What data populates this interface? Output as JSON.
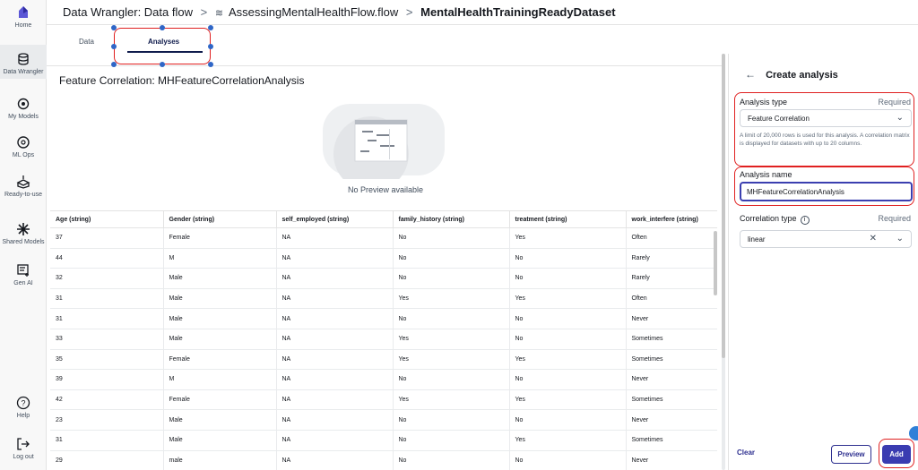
{
  "nav": {
    "items": [
      {
        "label": "Home",
        "icon": "home-icon"
      },
      {
        "label": "Data Wrangler",
        "icon": "data-wrangler-icon"
      },
      {
        "label": "My Models",
        "icon": "my-models-icon"
      },
      {
        "label": "ML Ops",
        "icon": "ml-ops-icon"
      },
      {
        "label": "Ready-to-use",
        "icon": "ready-to-use-icon"
      },
      {
        "label": "Shared Models",
        "icon": "shared-models-icon"
      },
      {
        "label": "Gen AI",
        "icon": "gen-ai-icon"
      },
      {
        "label": "Help",
        "icon": "help-icon"
      },
      {
        "label": "Log out",
        "icon": "logout-icon"
      }
    ]
  },
  "header": {
    "section": "Data Wrangler: Data flow",
    "flow": "AssessingMentalHealthFlow.flow",
    "dataset": "MentalHealthTrainingReadyDataset",
    "separator": ">"
  },
  "tabs": [
    "Data",
    "Analyses"
  ],
  "analysis": {
    "title": "Feature Correlation: MHFeatureCorrelationAnalysis",
    "no_preview": "No Preview available"
  },
  "table": {
    "columns": [
      "Age (string)",
      "Gender (string)",
      "self_employed (string)",
      "family_history (string)",
      "treatment (string)",
      "work_interfere (string)"
    ],
    "rows": [
      [
        "37",
        "Female",
        "NA",
        "No",
        "Yes",
        "Often"
      ],
      [
        "44",
        "M",
        "NA",
        "No",
        "No",
        "Rarely"
      ],
      [
        "32",
        "Male",
        "NA",
        "No",
        "No",
        "Rarely"
      ],
      [
        "31",
        "Male",
        "NA",
        "Yes",
        "Yes",
        "Often"
      ],
      [
        "31",
        "Male",
        "NA",
        "No",
        "No",
        "Never"
      ],
      [
        "33",
        "Male",
        "NA",
        "Yes",
        "No",
        "Sometimes"
      ],
      [
        "35",
        "Female",
        "NA",
        "Yes",
        "Yes",
        "Sometimes"
      ],
      [
        "39",
        "M",
        "NA",
        "No",
        "No",
        "Never"
      ],
      [
        "42",
        "Female",
        "NA",
        "Yes",
        "Yes",
        "Sometimes"
      ],
      [
        "23",
        "Male",
        "NA",
        "No",
        "No",
        "Never"
      ],
      [
        "31",
        "Male",
        "NA",
        "No",
        "Yes",
        "Sometimes"
      ],
      [
        "29",
        "male",
        "NA",
        "No",
        "No",
        "Never"
      ]
    ]
  },
  "panel": {
    "title": "Create analysis",
    "analysis_type_label": "Analysis type",
    "required": "Required",
    "analysis_type_value": "Feature Correlation",
    "help_text": "A limit of 20,000 rows is used for this analysis. A correlation matrix is displayed for datasets with up to 20 columns.",
    "analysis_name_label": "Analysis name",
    "analysis_name_value": "MHFeatureCorrelationAnalysis",
    "correlation_type_label": "Correlation type",
    "correlation_type_value": "linear",
    "clear_label": "Clear",
    "preview_label": "Preview",
    "add_label": "Add"
  },
  "colors": {
    "accent": "#3a3cb1",
    "highlight": "#e02020"
  }
}
